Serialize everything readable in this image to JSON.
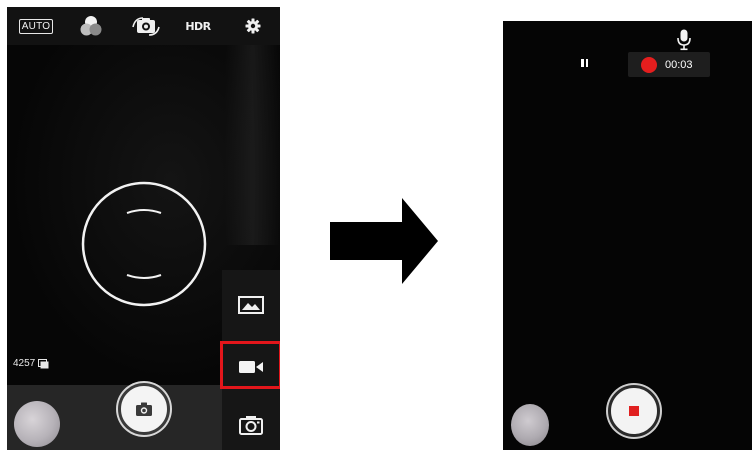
{
  "left_screen": {
    "top_bar": {
      "auto_label": "AUTO",
      "hdr_label": "HDR",
      "icons": [
        "color-effects-icon",
        "switch-camera-icon",
        "settings-icon"
      ]
    },
    "remaining_shots": "4257",
    "modes": [
      "panorama-mode-icon",
      "video-mode-icon",
      "photo-mode-icon"
    ],
    "selected_mode": "video",
    "highlight_color": "#e3161b"
  },
  "right_screen": {
    "recording_time": "00:03",
    "record_indicator_color": "#e51e1e",
    "icons": [
      "pause-icon",
      "microphone-icon",
      "stop-record-icon"
    ]
  }
}
